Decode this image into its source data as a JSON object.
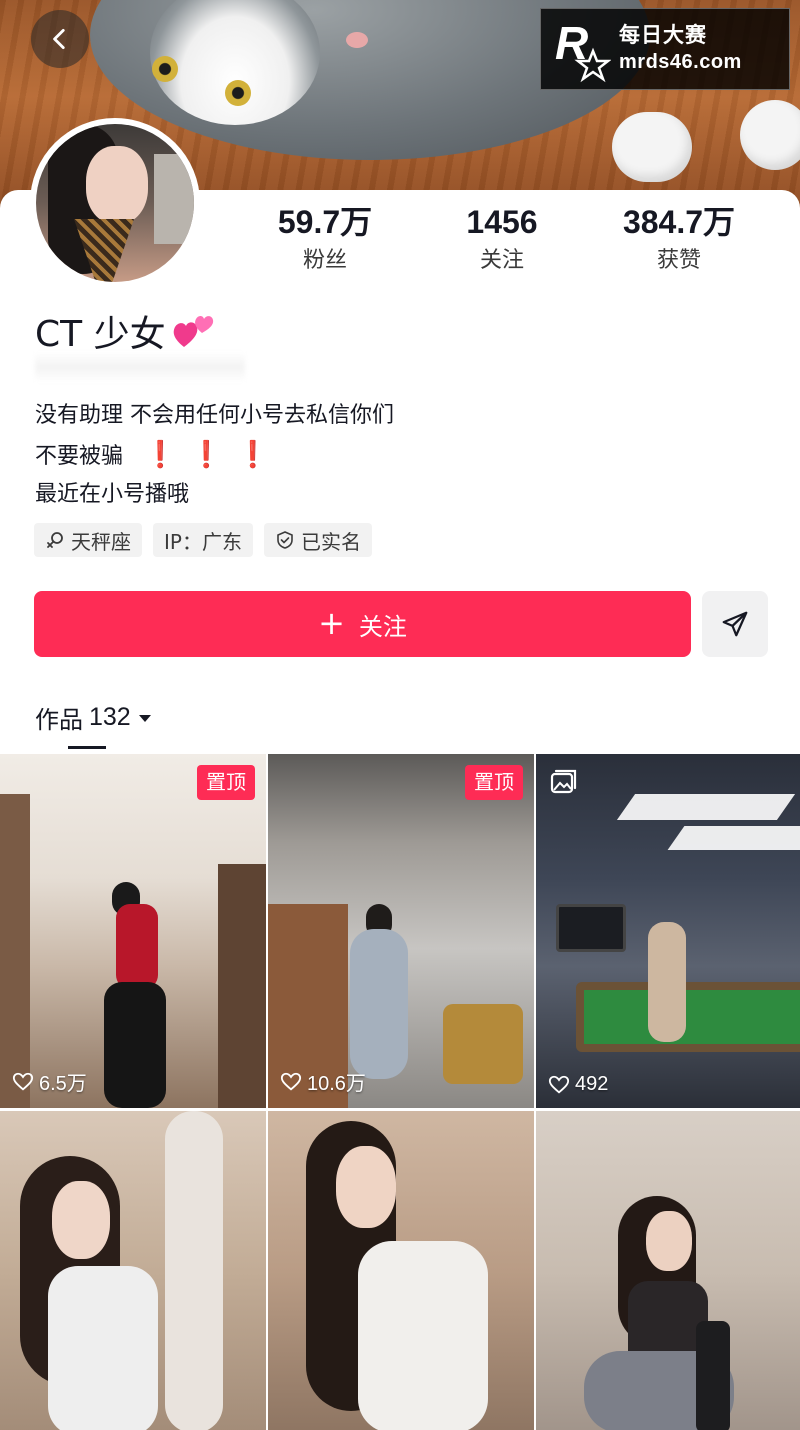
{
  "header": {
    "back_icon": "chevron-left-icon",
    "watermark": {
      "line1": "每日大赛",
      "line2": "mrds46.com"
    }
  },
  "profile": {
    "stats": [
      {
        "value": "59.7万",
        "label": "粉丝"
      },
      {
        "value": "1456",
        "label": "关注"
      },
      {
        "value": "384.7万",
        "label": "获赞"
      }
    ],
    "name": "CT 少女",
    "name_emoji": "two-hearts-emoji",
    "bio": {
      "line1": "没有助理 不会用任何小号去私信你们",
      "line2": "不要被骗",
      "line2_marks": [
        "❗",
        "❗",
        "❗"
      ],
      "line3": "最近在小号播哦"
    },
    "tags": [
      {
        "icon": "female-symbol-icon",
        "text": "天秤座"
      },
      {
        "icon": "",
        "text": "IP：广东"
      },
      {
        "icon": "verified-shield-icon",
        "text": "已实名"
      }
    ]
  },
  "actions": {
    "follow_label": "关注",
    "follow_color": "#fe2c55",
    "message_icon": "send-message-icon"
  },
  "works": {
    "tab_label": "作品",
    "count": "132",
    "items": [
      {
        "pinned_label": "置顶",
        "likes": "6.5万"
      },
      {
        "pinned_label": "置顶",
        "likes": "10.6万"
      },
      {
        "type": "image-post",
        "likes": "492"
      },
      {
        "likes": ""
      },
      {
        "likes": ""
      },
      {
        "likes": ""
      }
    ]
  }
}
